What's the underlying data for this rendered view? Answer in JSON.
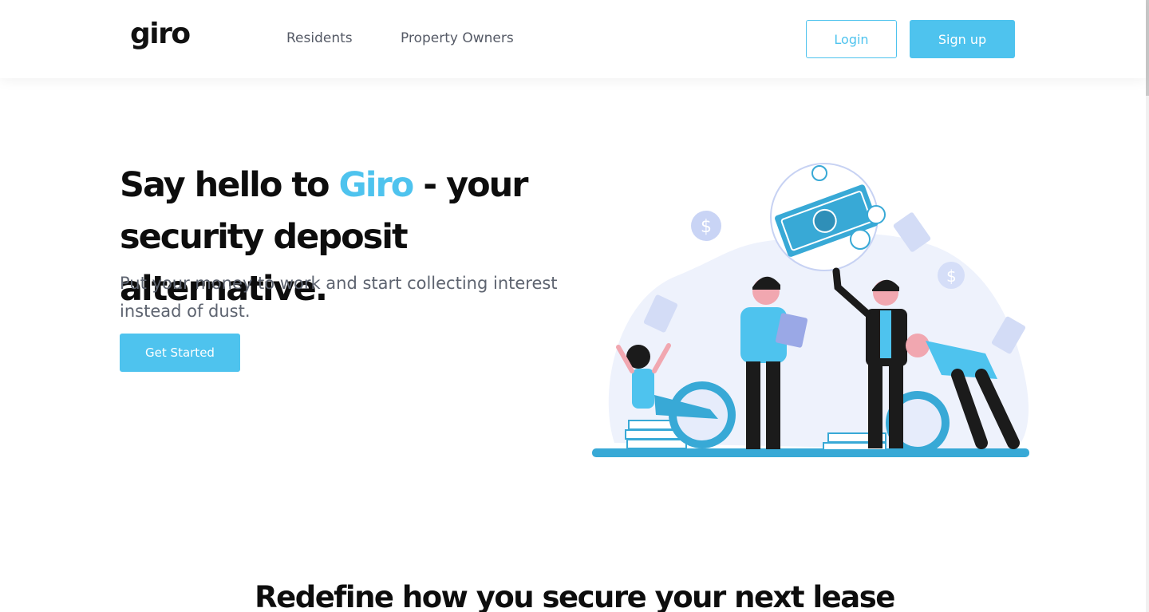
{
  "header": {
    "logo": "giro",
    "nav": [
      {
        "label": "Residents"
      },
      {
        "label": "Property Owners"
      }
    ],
    "login_label": "Login",
    "signup_label": "Sign up"
  },
  "hero": {
    "headline_part1": "Say hello to ",
    "headline_brand": "Giro",
    "headline_part2": " - your security deposit alternative.",
    "subtext": "Put your money to work and start collecting interest instead of dust.",
    "cta_label": "Get Started"
  },
  "section2": {
    "title": "Redefine how you secure your next lease"
  },
  "colors": {
    "accent": "#4ec3ee",
    "dark": "#0d0d0d",
    "muted": "#5e6470"
  }
}
